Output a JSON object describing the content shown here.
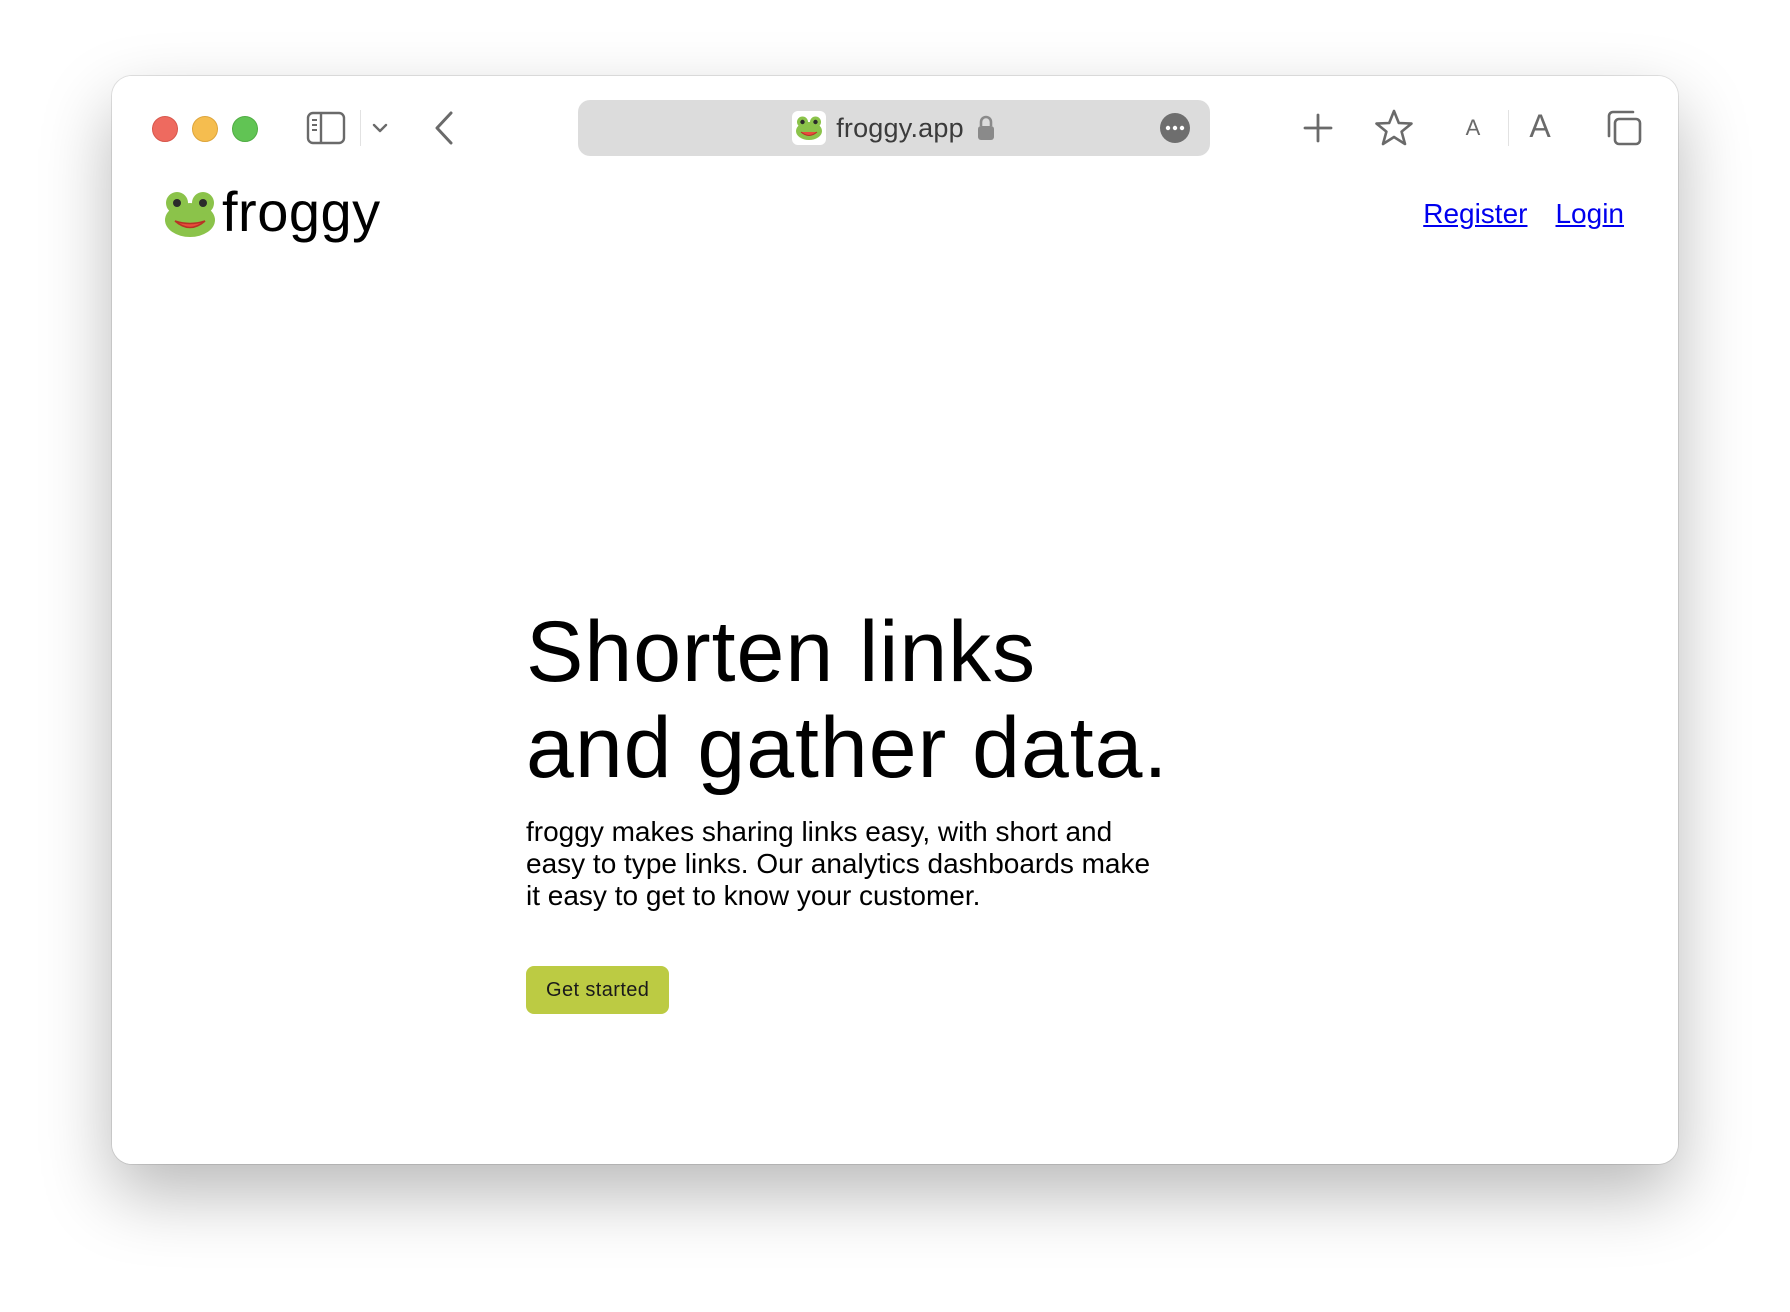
{
  "browser": {
    "address_bar": {
      "url": "froggy.app"
    },
    "icons": {
      "sidebar": "sidebar-icon",
      "chevron": "chevron-down-icon",
      "back": "back-arrow-icon",
      "favicon": "frog-emoji-icon",
      "lock": "lock-icon",
      "more": "ellipsis-circle-icon",
      "new_tab": "plus-icon",
      "bookmark": "star-icon",
      "tabs": "tab-overview-icon"
    },
    "font_small_label": "A",
    "font_large_label": "A"
  },
  "site": {
    "brand_name": "froggy",
    "logo_icon": "frog-emoji-icon",
    "nav": {
      "register": "Register",
      "login": "Login"
    },
    "hero": {
      "title_line1": "Shorten links",
      "title_line2": "and gather data.",
      "description": "froggy makes sharing links easy, with short and easy to type links. Our analytics dashboards make it easy to get to know your customer.",
      "cta_label": "Get started"
    }
  },
  "colors": {
    "link": "#0000ee",
    "cta_background": "#bccb43",
    "close": "#ee6a5f",
    "minimize": "#f5bd4f",
    "maximize": "#61c454"
  }
}
